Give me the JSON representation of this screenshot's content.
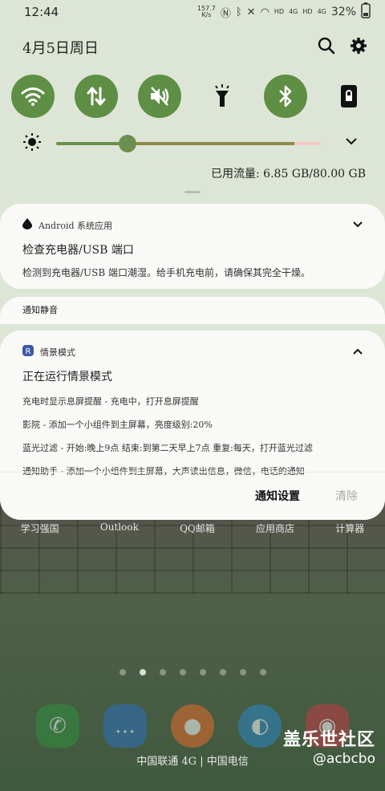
{
  "status_bar": {
    "time": "12:44",
    "speed_value": "157.7",
    "speed_unit": "K/s",
    "network_1": "4G",
    "network_2": "4G",
    "hd_1": "HD",
    "hd_2": "HD",
    "battery": "32%"
  },
  "header": {
    "date": "4月5日周日",
    "search_icon": "search-icon",
    "settings_icon": "gear-icon"
  },
  "quick_settings": [
    {
      "name": "wifi",
      "icon": "wifi-icon",
      "on": true
    },
    {
      "name": "mobile-data",
      "icon": "data-arrows-icon",
      "on": true
    },
    {
      "name": "sound",
      "icon": "vibrate-icon",
      "on": true
    },
    {
      "name": "flashlight",
      "icon": "flashlight-icon",
      "on": false
    },
    {
      "name": "bluetooth",
      "icon": "bluetooth-icon",
      "on": true
    },
    {
      "name": "lock-rotation",
      "icon": "lock-icon",
      "on": false
    }
  ],
  "brightness": {
    "level": 0.27
  },
  "data_usage": "已用流量: 6.85 GB/80.00 GB",
  "colors": {
    "accent": "#5f8e45",
    "shade_bg": "#dde6d6",
    "card_bg": "#f9faf7"
  },
  "notifications": {
    "charger": {
      "app": "Android 系统应用",
      "title": "检查充电器/USB 端口",
      "text": "检测到充电器/USB 端口潮湿。给手机充电前，请确保其完全干燥。"
    },
    "silent": {
      "label": "通知静音"
    },
    "scenes": {
      "app": "情景模式",
      "title": "正在运行情景模式",
      "lines": [
        "充电时显示息屏提醒 - 充电中，打开息屏提醒",
        "影院 - 添加一个小组件到主屏幕，亮度级别:20%",
        "蓝光过滤 - 开始:晚上9点  结束:到第二天早上7点  重复:每天，打开蓝光过滤",
        "通知助手 - 添加一个小组件到主屏幕，大声读出信息，微信，电话的通知"
      ],
      "settings_button": "通知设置",
      "clear_button": "清除"
    }
  },
  "home_screen": {
    "app_labels": [
      "学习强国",
      "Outlook",
      "QQ邮箱",
      "应用商店",
      "计算器"
    ],
    "carrier": "中国联通 4G | 中国电信",
    "watermark_title": "盖乐世社区",
    "watermark_handle": "@acbcbo"
  }
}
